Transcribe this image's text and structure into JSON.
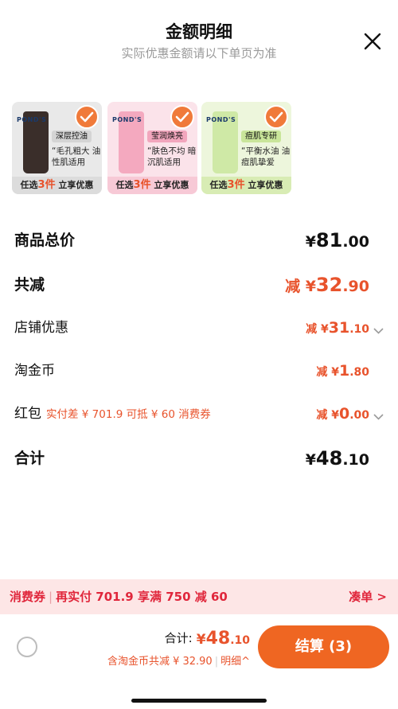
{
  "header": {
    "title": "金额明细",
    "subtitle": "实际优惠金额请以下单页为准"
  },
  "products": [
    {
      "brand": "POND'S",
      "tag": "深层控油",
      "desc": "“毛孔粗大 油性肌适用",
      "footer_pre": "任选",
      "footer_num": "3件",
      "footer_post": " 立享优惠",
      "card_bg": "#e9e9e9",
      "tag_bg": "#d4d4d4",
      "tube": "#3a2e2a",
      "foot_bg": "#dcdcdc"
    },
    {
      "brand": "POND'S",
      "tag": "莹润焕亮",
      "desc": "“肤色不均 暗沉肌适用",
      "footer_pre": "任选",
      "footer_num": "3件",
      "footer_post": " 立享优惠",
      "card_bg": "#fbe3ea",
      "tag_bg": "#f2a6bd",
      "tube": "#f4a9bf",
      "foot_bg": "#f7c9d6"
    },
    {
      "brand": "POND'S",
      "tag": "痘肌专研",
      "desc": "“平衡水油 油痘肌挚爱",
      "footer_pre": "任选",
      "footer_num": "3件",
      "footer_post": " 立享优惠",
      "card_bg": "#edf6dc",
      "tag_bg": "#c9e59a",
      "tube": "#cfe9a6",
      "foot_bg": "#d8ecb4"
    }
  ],
  "rows": {
    "total_price": {
      "label": "商品总价",
      "yen": "¥",
      "int": "81",
      "dec": ".00"
    },
    "total_reduce": {
      "label": "共减",
      "prefix": "减 ¥",
      "int": "32",
      "dec": ".90"
    },
    "store_discount": {
      "label": "店铺优惠",
      "prefix": "减 ¥",
      "int": "31",
      "dec": ".10"
    },
    "taojinbi": {
      "label": "淘金币",
      "prefix": "减 ¥",
      "int": "1",
      "dec": ".80"
    },
    "hongbao": {
      "label": "红包",
      "note": "实付差 ¥ 701.9 可抵 ¥ 60 消费券",
      "prefix": "减 ¥",
      "int": "0",
      "dec": ".00"
    },
    "subtotal": {
      "label": "合计",
      "yen": "¥",
      "int": "48",
      "dec": ".10"
    }
  },
  "banner": {
    "left_a": "消费券",
    "left_sep": "|",
    "left_b": "再实付 701.9 享满 750 减 60",
    "right": "凑单 >"
  },
  "bottom": {
    "total_label": "合计:",
    "total_yen": "¥",
    "total_int": "48",
    "total_dec": ".10",
    "sub_a": "含淘金币共减 ¥ 32.90",
    "sub_sep": "|",
    "sub_b": "明细^",
    "pay_label": "结算 (3)"
  },
  "colors": {
    "accent": "#ef6622",
    "discount_red": "#e8532c",
    "banner_bg": "#fde6e6",
    "banner_text": "#e0263b"
  }
}
